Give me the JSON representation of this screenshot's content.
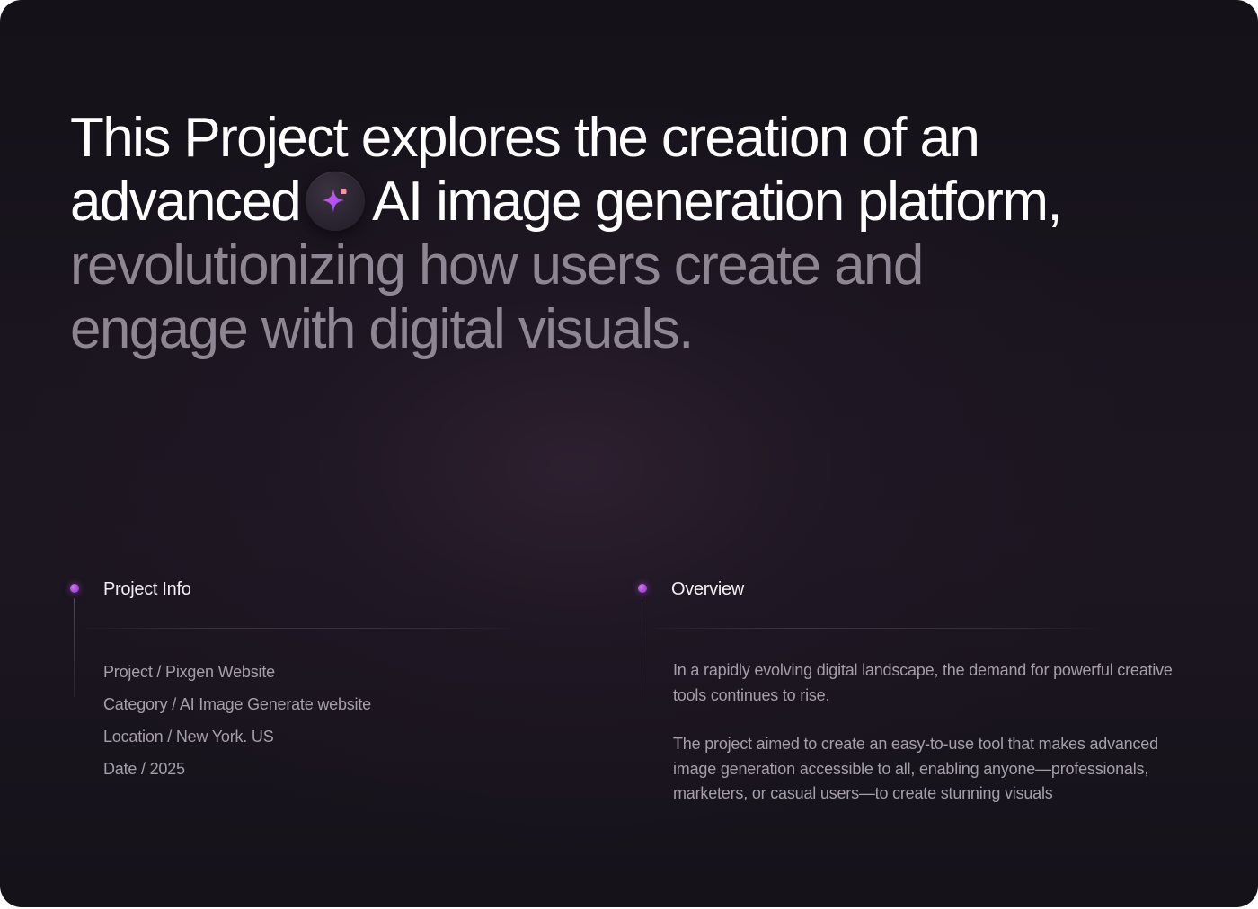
{
  "headline": {
    "part1": "This Project explores the creation of an advanced",
    "part2": "AI image generation platform,",
    "part3": "revolutionizing how users create and engage with digital visuals."
  },
  "icons": {
    "sparkle_badge": "sparkle-icon",
    "bullet": "purple-dot"
  },
  "colors": {
    "background": "#17131b",
    "headline_primary": "#ffffff",
    "headline_muted": "#8e8692",
    "body_text": "#a69fab",
    "accent": "#b44ee6",
    "sparkle_gradient_start": "#e05be8",
    "sparkle_gradient_end": "#8a4cf0",
    "sparkle_square": "#ff8fa3"
  },
  "project_info": {
    "title": "Project Info",
    "items": [
      "Project / Pixgen Website",
      "Category / AI Image Generate website",
      "Location / New York. US",
      "Date / 2025"
    ]
  },
  "overview": {
    "title": "Overview",
    "paragraphs": [
      "In a rapidly evolving digital landscape, the demand for powerful creative tools continues to rise.",
      "The project aimed to create an easy-to-use tool that makes advanced image generation accessible to all, enabling anyone—professionals, marketers, or casual users—to create stunning visuals"
    ]
  }
}
